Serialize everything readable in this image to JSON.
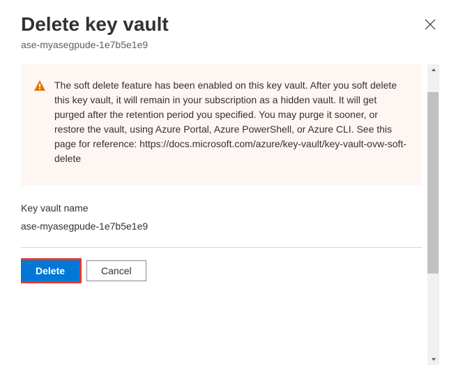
{
  "header": {
    "title": "Delete key vault",
    "subtitle": "ase-myasegpude-1e7b5e1e9"
  },
  "warning": {
    "text": "The soft delete feature has been enabled on this key vault. After you soft delete this key vault, it will remain in your subscription as a hidden vault. It will get purged after the retention period you specified. You may purge it sooner, or restore the vault, using Azure Portal, Azure PowerShell, or Azure CLI. See this page for reference: https://docs.microsoft.com/azure/key-vault/key-vault-ovw-soft-delete"
  },
  "field": {
    "label": "Key vault name",
    "value": "ase-myasegpude-1e7b5e1e9"
  },
  "buttons": {
    "delete": "Delete",
    "cancel": "Cancel"
  }
}
